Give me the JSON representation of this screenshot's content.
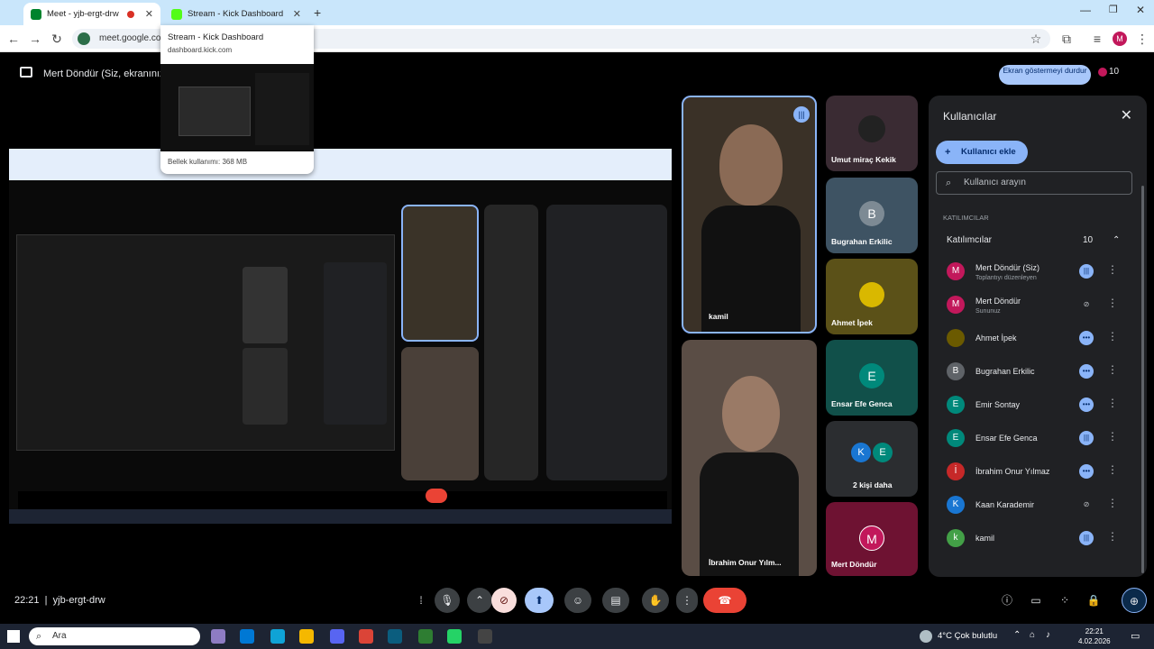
{
  "browser": {
    "tabs": [
      {
        "title": "Meet - yjb-ergt-drw",
        "active": true
      },
      {
        "title": "Stream - Kick Dashboard",
        "active": false
      }
    ],
    "url": "meet.google.com",
    "hover_card": {
      "title": "Stream - Kick Dashboard",
      "domain": "dashboard.kick.com",
      "memory": "Bellek kullanımı: 368 MB"
    }
  },
  "meet": {
    "presenting_label": "Mert Döndür (Siz, ekranınızı",
    "stop_presenting": "Ekran göstermeyi durdur",
    "people_count": "10",
    "meeting_time": "22:21",
    "meeting_code": "yjb-ergt-drw"
  },
  "tiles": {
    "kamil": "kamil",
    "umut": "Umut miraç Kekik",
    "bugrahan": "Bugrahan Erkilic",
    "bugrahan_initial": "B",
    "ahmet": "Ahmet İpek",
    "ensar": "Ensar Efe Genca",
    "ensar_initial": "E",
    "more_label": "2 kişi daha",
    "more_initial_1": "K",
    "more_initial_2": "E",
    "ibrahim": "İbrahim Onur Yılm...",
    "mert": "Mert Döndür",
    "mert_initial": "M"
  },
  "panel": {
    "title": "Kullanıcılar",
    "add_user": "Kullanıcı ekle",
    "search_placeholder": "Kullanıcı arayın",
    "section": "KATILIMCILAR",
    "group_label": "Katılımcılar",
    "group_count": "10",
    "participants": [
      {
        "name": "Mert Döndür (Siz)",
        "sub": "Toplantıyı düzenleyen",
        "initial": "M",
        "color": "#c2185b",
        "mic": "active"
      },
      {
        "name": "Mert Döndür",
        "sub": "Sununuz",
        "initial": "M",
        "color": "#c2185b",
        "mic": "muted"
      },
      {
        "name": "Ahmet İpek",
        "sub": "",
        "initial": "",
        "color": "#6b5a00",
        "mic": "more"
      },
      {
        "name": "Bugrahan Erkilic",
        "sub": "",
        "initial": "B",
        "color": "#5f6368",
        "mic": "more"
      },
      {
        "name": "Emir Sontay",
        "sub": "",
        "initial": "E",
        "color": "#00897b",
        "mic": "more"
      },
      {
        "name": "Ensar Efe Genca",
        "sub": "",
        "initial": "E",
        "color": "#00897b",
        "mic": "active"
      },
      {
        "name": "İbrahim Onur Yılmaz",
        "sub": "",
        "initial": "İ",
        "color": "#c62828",
        "mic": "more"
      },
      {
        "name": "Kaan Karademir",
        "sub": "",
        "initial": "K",
        "color": "#1976d2",
        "mic": "muted"
      },
      {
        "name": "kamil",
        "sub": "",
        "initial": "k",
        "color": "#43a047",
        "mic": "active"
      }
    ]
  },
  "taskbar": {
    "search": "Ara",
    "weather": "4°C  Çok bulutlu",
    "time": "22:21",
    "date": "4.02.2026"
  },
  "colors": {
    "accent_blue": "#8ab4f8",
    "end_call_red": "#ea4335",
    "panel_bg": "#202124",
    "tab_strip": "#c9e6fb"
  }
}
